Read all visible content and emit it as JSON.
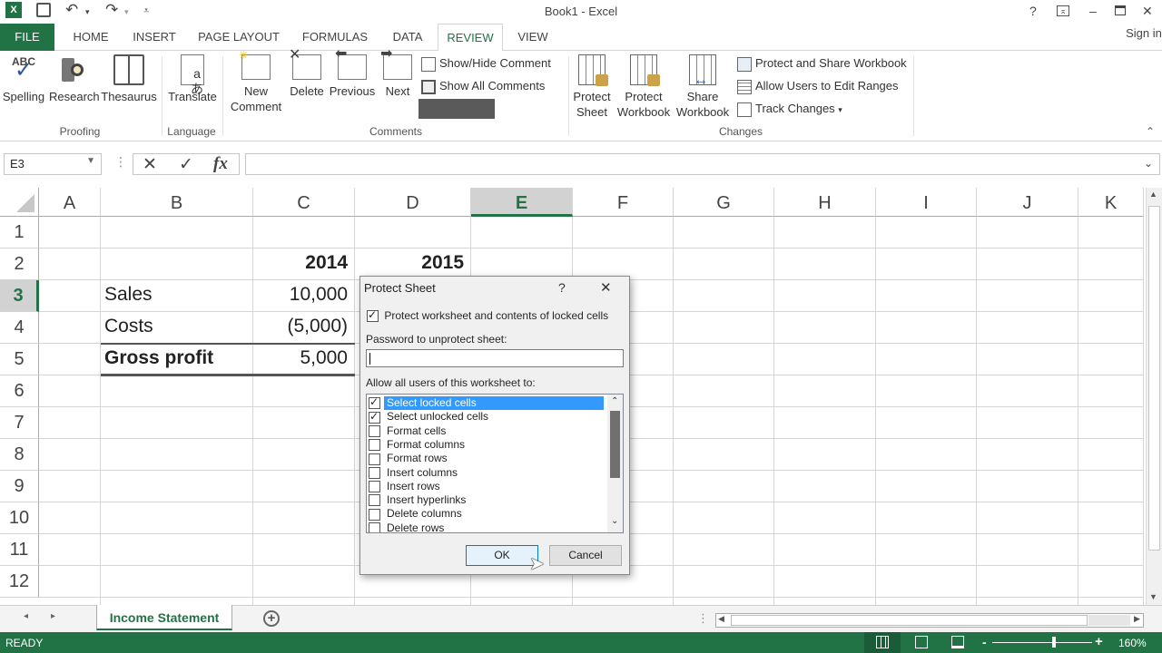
{
  "window": {
    "title": "Book1 - Excel",
    "help": "?",
    "ribbon_display": "⊼",
    "minimize": "–",
    "maximize": "☐",
    "close": "✕",
    "sign_in": "Sign in"
  },
  "qat": {
    "save": "save-icon",
    "undo": "↶",
    "undo_dd": "▾",
    "redo": "↷",
    "redo_dd": "▾",
    "customize": "⩡"
  },
  "tabs": [
    {
      "label": "FILE"
    },
    {
      "label": "HOME"
    },
    {
      "label": "INSERT"
    },
    {
      "label": "PAGE LAYOUT"
    },
    {
      "label": "FORMULAS"
    },
    {
      "label": "DATA"
    },
    {
      "label": "REVIEW",
      "active": true
    },
    {
      "label": "VIEW"
    }
  ],
  "ribbon": {
    "proofing": {
      "label": "Proofing",
      "spelling": "Spelling",
      "spelling_abc": "ABC",
      "research": "Research",
      "thesaurus": "Thesaurus"
    },
    "language": {
      "label": "Language",
      "translate": "Translate"
    },
    "comments": {
      "label": "Comments",
      "new_comment_1": "New",
      "new_comment_2": "Comment",
      "delete": "Delete",
      "previous": "Previous",
      "next": "Next",
      "show_hide": "Show/Hide Comment",
      "show_all": "Show All Comments",
      "show_ink": ""
    },
    "changes": {
      "label": "Changes",
      "protect_sheet_1": "Protect",
      "protect_sheet_2": "Sheet",
      "protect_workbook_1": "Protect",
      "protect_workbook_2": "Workbook",
      "share_workbook_1": "Share",
      "share_workbook_2": "Workbook",
      "protect_share": "Protect and Share Workbook",
      "allow_users": "Allow Users to Edit Ranges",
      "track_changes": "Track Changes",
      "track_dd": "▾"
    }
  },
  "formula_bar": {
    "name_box": "E3",
    "cancel": "✕",
    "enter": "✓",
    "fx": "fx",
    "value": ""
  },
  "grid": {
    "columns": [
      "A",
      "B",
      "C",
      "D",
      "E",
      "F",
      "G",
      "H",
      "I",
      "J",
      "K"
    ],
    "selected_column": "E",
    "rows": [
      "1",
      "2",
      "3",
      "4",
      "5",
      "6",
      "7",
      "8",
      "9",
      "10",
      "11",
      "12"
    ],
    "selected_row": "3",
    "cells": {
      "C2": "2014",
      "D2": "2015",
      "B3": "Sales",
      "C3": "10,000",
      "B4": "Costs",
      "C4": "(5,000)",
      "B5": "Gross profit",
      "C5": "5,000"
    }
  },
  "sheet_tabs": {
    "prev": "◂",
    "next": "▸",
    "active": "Income Statement",
    "add": "+"
  },
  "status": {
    "text": "READY",
    "zoom": "160%",
    "zoom_minus": "-",
    "zoom_plus": "+",
    "zoom_fraction": 0.6
  },
  "dialog": {
    "title": "Protect Sheet",
    "help": "?",
    "close": "✕",
    "protect_label": "Protect worksheet and contents of locked cells",
    "protect_checked": true,
    "password_label": "Password to unprotect sheet:",
    "password_value": "",
    "allow_label": "Allow all users of this worksheet to:",
    "options": [
      {
        "label": "Select locked cells",
        "checked": true,
        "highlighted": true
      },
      {
        "label": "Select unlocked cells",
        "checked": true
      },
      {
        "label": "Format cells",
        "checked": false
      },
      {
        "label": "Format columns",
        "checked": false
      },
      {
        "label": "Format rows",
        "checked": false
      },
      {
        "label": "Insert columns",
        "checked": false
      },
      {
        "label": "Insert rows",
        "checked": false
      },
      {
        "label": "Insert hyperlinks",
        "checked": false
      },
      {
        "label": "Delete columns",
        "checked": false
      },
      {
        "label": "Delete rows",
        "checked": false
      }
    ],
    "ok": "OK",
    "cancel": "Cancel"
  }
}
